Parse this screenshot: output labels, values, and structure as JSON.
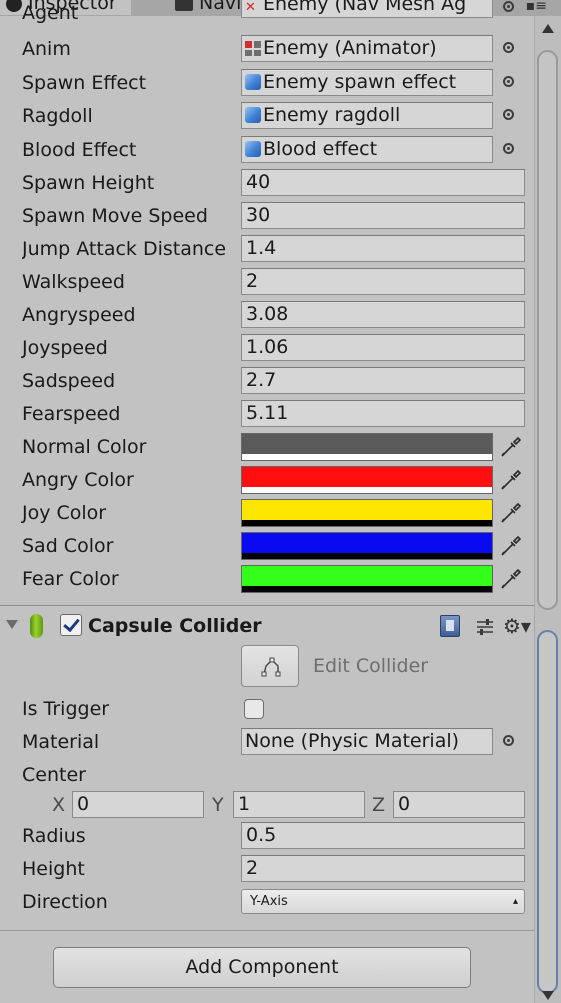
{
  "tabs": {
    "inspector": "Inspector",
    "navigation": "Navigation"
  },
  "fields": {
    "agent": {
      "label": "Agent",
      "value": "Enemy (Nav Mesh Ag"
    },
    "anim": {
      "label": "Anim",
      "value": "Enemy (Animator)"
    },
    "spawn_effect": {
      "label": "Spawn Effect",
      "value": "Enemy spawn effect"
    },
    "ragdoll": {
      "label": "Ragdoll",
      "value": "Enemy ragdoll"
    },
    "blood_effect": {
      "label": "Blood Effect",
      "value": "Blood effect"
    },
    "spawn_height": {
      "label": "Spawn Height",
      "value": "40"
    },
    "spawn_move_speed": {
      "label": "Spawn Move Speed",
      "value": "30"
    },
    "jump_attack_distance": {
      "label": "Jump Attack Distance",
      "value": "1.4"
    },
    "walkspeed": {
      "label": "Walkspeed",
      "value": "2"
    },
    "angryspeed": {
      "label": "Angryspeed",
      "value": "3.08"
    },
    "joyspeed": {
      "label": "Joyspeed",
      "value": "1.06"
    },
    "sadspeed": {
      "label": "Sadspeed",
      "value": "2.7"
    },
    "fearspeed": {
      "label": "Fearspeed",
      "value": "5.11"
    }
  },
  "colors": {
    "normal": {
      "label": "Normal Color",
      "color": "#5a5a5a",
      "alpha": "#ffffff"
    },
    "angry": {
      "label": "Angry Color",
      "color": "#ff0f0f",
      "alpha": "#ffffff"
    },
    "joy": {
      "label": "Joy Color",
      "color": "#ffe600",
      "alpha": "#000000"
    },
    "sad": {
      "label": "Sad Color",
      "color": "#0a0af0",
      "alpha": "#000000"
    },
    "fear": {
      "label": "Fear Color",
      "color": "#33ff1a",
      "alpha": "#000000"
    }
  },
  "capsule_collider": {
    "title": "Capsule Collider",
    "edit_collider": "Edit Collider",
    "is_trigger": {
      "label": "Is Trigger"
    },
    "material": {
      "label": "Material",
      "value": "None (Physic Material)"
    },
    "center": {
      "label": "Center",
      "x_label": "X",
      "x": "0",
      "y_label": "Y",
      "y": "1",
      "z_label": "Z",
      "z": "0"
    },
    "radius": {
      "label": "Radius",
      "value": "0.5"
    },
    "height": {
      "label": "Height",
      "value": "2"
    },
    "direction": {
      "label": "Direction",
      "value": "Y-Axis"
    }
  },
  "add_component": "Add Component"
}
